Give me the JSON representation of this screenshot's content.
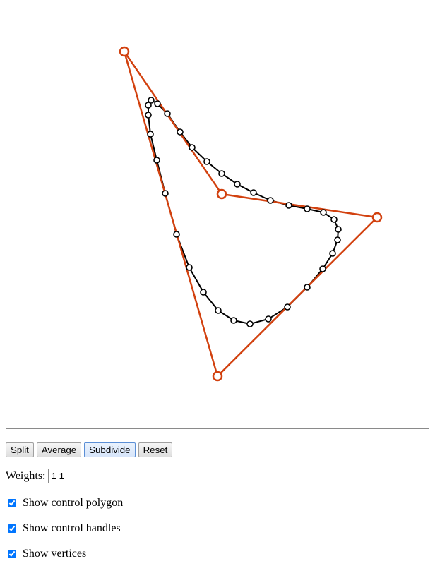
{
  "canvas": {
    "control_color": "#d2410f",
    "curve_color": "#000000",
    "vertex_fill": "#ffffff"
  },
  "toolbar": {
    "buttons": [
      {
        "label": "Split"
      },
      {
        "label": "Average"
      },
      {
        "label": "Subdivide",
        "active": true
      },
      {
        "label": "Reset"
      }
    ]
  },
  "weights": {
    "label": "Weights:",
    "value": "1 1"
  },
  "options": [
    {
      "label": "Show control polygon",
      "checked": true
    },
    {
      "label": "Show control handles",
      "checked": true
    },
    {
      "label": "Show vertices",
      "checked": true
    }
  ]
}
